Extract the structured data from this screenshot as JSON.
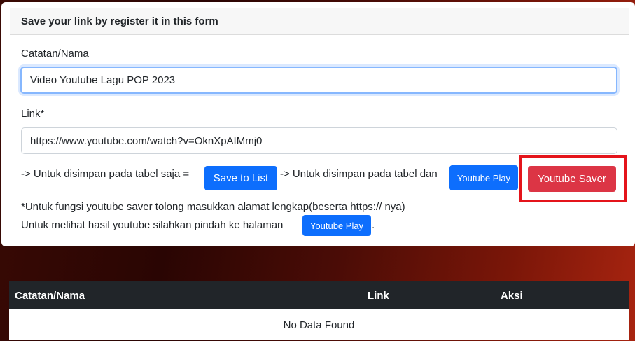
{
  "form": {
    "header": "Save your link by register it in this form",
    "name_label": "Catatan/Nama",
    "name_value": "Video Youtube Lagu POP 2023",
    "link_label": "Link*",
    "link_value": "https://www.youtube.com/watch?v=OknXpAIMmj0",
    "save_text": "-> Untuk disimpan pada tabel saja =",
    "save_button": "Save to List",
    "play_text": "-> Untuk disimpan pada tabel dan",
    "play_button": "Youtube Play",
    "saver_button": "Youtube Saver",
    "note_text": "*Untuk fungsi youtube saver tolong masukkan alamat lengkap(beserta https:// nya)",
    "result_text": "Untuk melihat hasil youtube silahkan pindah ke halaman",
    "result_button": "Youtube Play",
    "result_suffix": "."
  },
  "table": {
    "columns": [
      "Catatan/Nama",
      "Link",
      "Aksi"
    ],
    "empty_message": "No Data Found"
  },
  "colors": {
    "primary": "#0d6efd",
    "danger": "#dc3545",
    "highlight": "#e4141b",
    "table_header": "#212529"
  }
}
